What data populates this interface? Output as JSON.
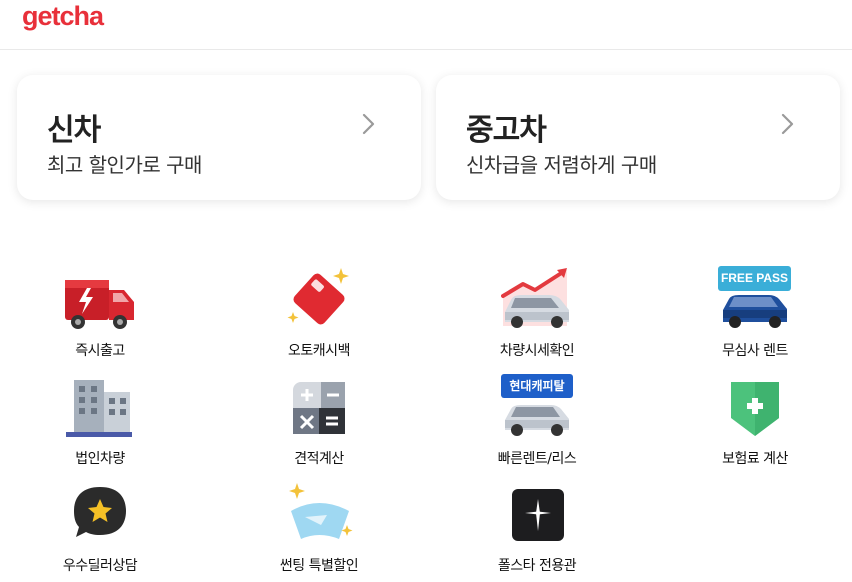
{
  "header": {
    "logo": "getcha"
  },
  "cards": [
    {
      "title": "신차",
      "subtitle": "최고 할인가로 구매"
    },
    {
      "title": "중고차",
      "subtitle": "신차급을 저렴하게 구매"
    }
  ],
  "menu": [
    {
      "label": "즉시출고",
      "icon": "truck-icon"
    },
    {
      "label": "오토캐시백",
      "icon": "card-icon"
    },
    {
      "label": "차량시세확인",
      "icon": "car-price-chart-icon"
    },
    {
      "label": "무심사 렌트",
      "icon": "free-pass-car-icon",
      "badge": "FREE PASS"
    },
    {
      "label": "법인차량",
      "icon": "building-icon"
    },
    {
      "label": "견적계산",
      "icon": "calculator-icon"
    },
    {
      "label": "빠른렌트/리스",
      "icon": "hyundai-capital-car-icon",
      "badge": "현대캐피탈"
    },
    {
      "label": "보험료 계산",
      "icon": "insurance-shield-icon"
    },
    {
      "label": "우수딜러상담",
      "icon": "chat-star-icon"
    },
    {
      "label": "썬팅 특별할인",
      "icon": "windshield-icon"
    },
    {
      "label": "폴스타 전용관",
      "icon": "polestar-icon"
    }
  ],
  "colors": {
    "brand": "#e8303a",
    "accent_blue": "#1e5fc9",
    "free_pass_badge": "#3aaed8",
    "insurance_green": "#4cc27c"
  }
}
